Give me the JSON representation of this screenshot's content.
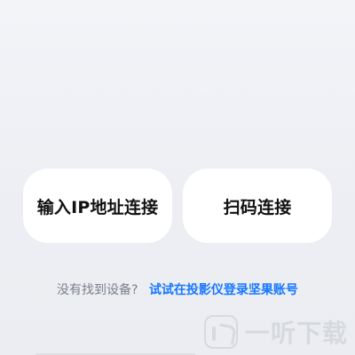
{
  "actions": {
    "manual_ip_connect_label": "输入IP地址连接",
    "scan_qr_connect_label": "扫码连接"
  },
  "help": {
    "question": "没有找到设备?",
    "link_text": "试试在投影仪登录坚果账号"
  },
  "watermark": {
    "text": "一听下载",
    "icon": "yiting-logo-icon"
  },
  "colors": {
    "link": "#1677ff",
    "button_bg": "#ffffff",
    "bg": "#eceef3"
  }
}
